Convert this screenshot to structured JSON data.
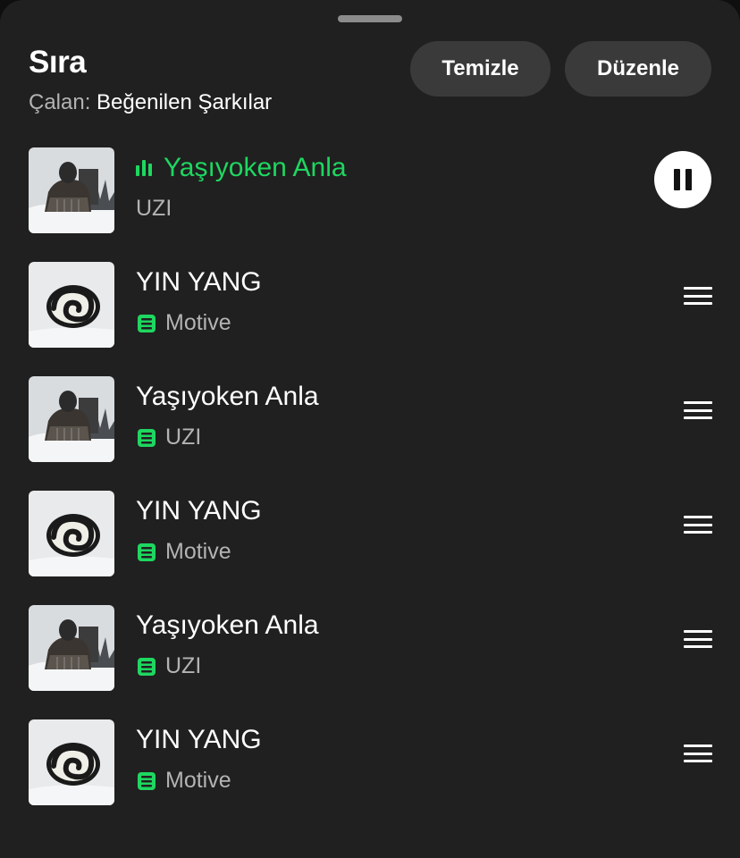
{
  "header": {
    "title": "Sıra",
    "playing_prefix": "Çalan:",
    "playing_source": "Beğenilen Şarkılar",
    "clear_label": "Temizle",
    "edit_label": "Düzenle"
  },
  "colors": {
    "accent": "#1ed760",
    "background": "#202020",
    "pill": "#3a3a3a",
    "muted": "#b3b3b3"
  },
  "queue": [
    {
      "title": "Yaşıyoken Anla",
      "artist": "UZI",
      "now_playing": true,
      "cover": "portrait-cover"
    },
    {
      "title": "YIN YANG",
      "artist": "Motive",
      "now_playing": false,
      "cover": "spiral-cover"
    },
    {
      "title": "Yaşıyoken Anla",
      "artist": "UZI",
      "now_playing": false,
      "cover": "portrait-cover"
    },
    {
      "title": "YIN YANG",
      "artist": "Motive",
      "now_playing": false,
      "cover": "spiral-cover"
    },
    {
      "title": "Yaşıyoken Anla",
      "artist": "UZI",
      "now_playing": false,
      "cover": "portrait-cover"
    },
    {
      "title": "YIN YANG",
      "artist": "Motive",
      "now_playing": false,
      "cover": "spiral-cover"
    }
  ],
  "icons": {
    "pause": "pause-icon",
    "drag": "drag-handle-icon",
    "source": "queue-source-icon",
    "playing": "equalizer-icon"
  }
}
